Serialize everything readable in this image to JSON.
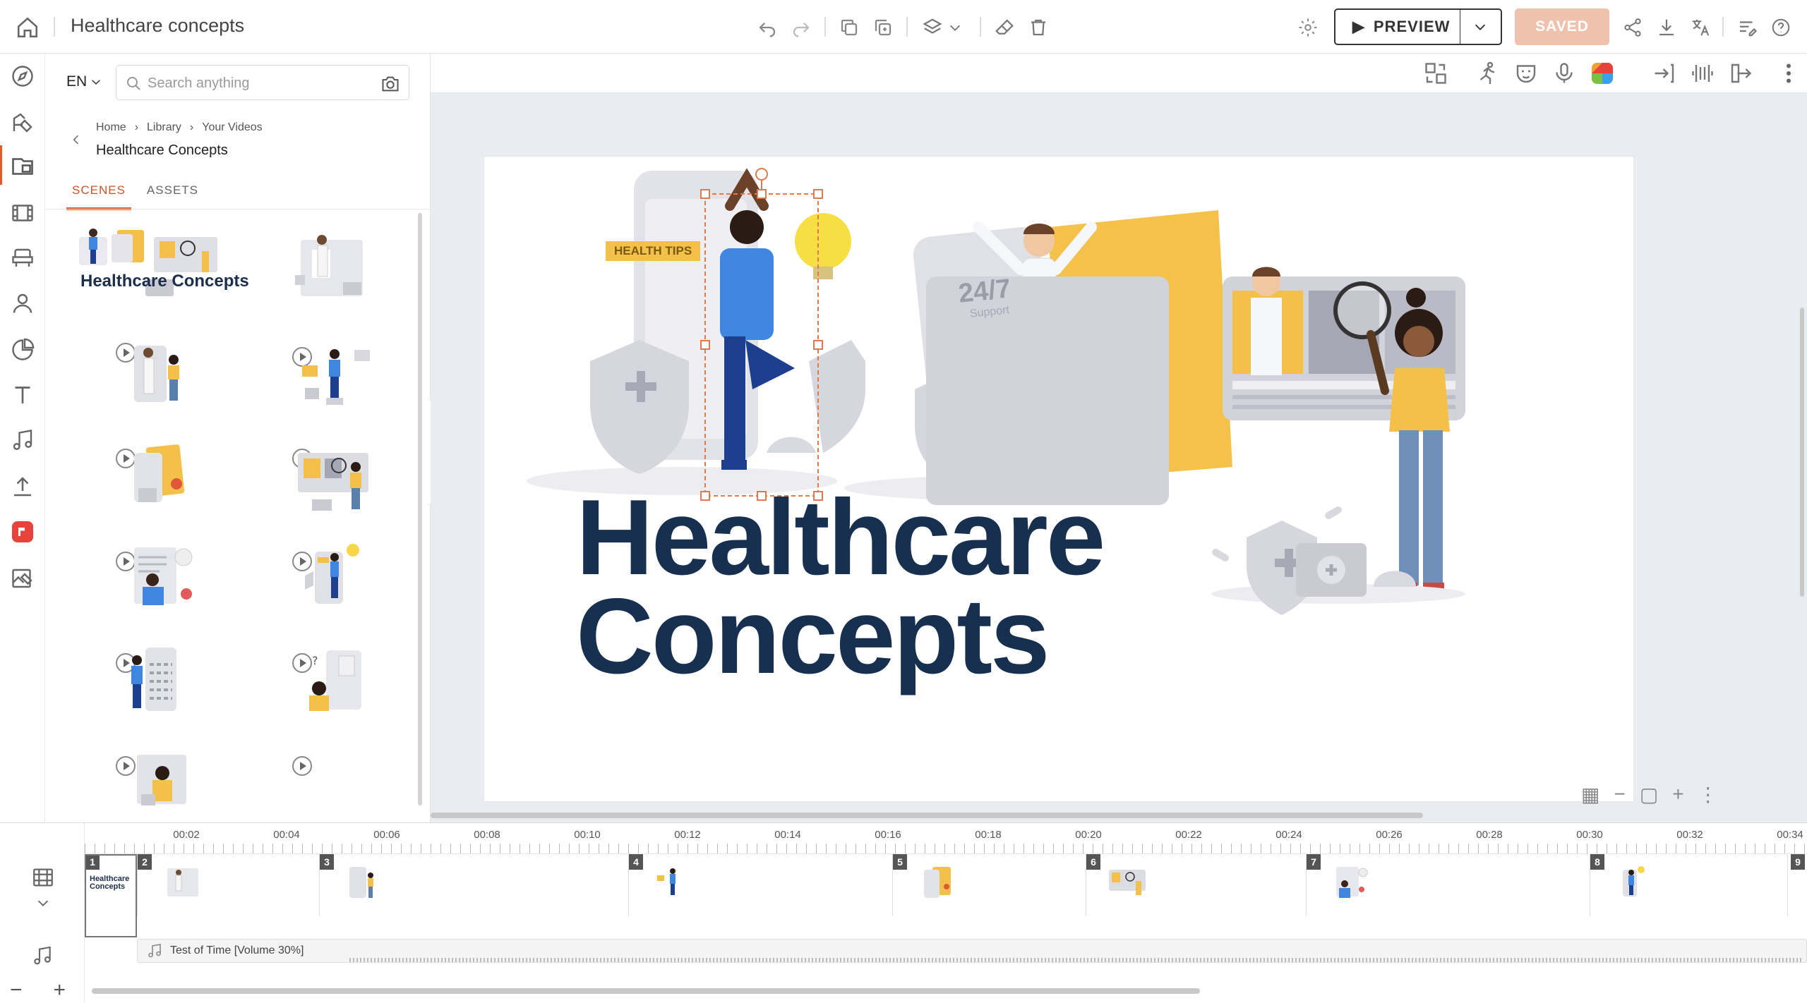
{
  "header": {
    "title": "Healthcare concepts",
    "preview_label": "PREVIEW",
    "saved_label": "SAVED"
  },
  "panel": {
    "language": "EN",
    "search": {
      "placeholder": "Search anything",
      "value": ""
    },
    "breadcrumbs": [
      "Home",
      "Library",
      "Your Videos"
    ],
    "current_folder": "Healthcare Concepts",
    "tabs": [
      "SCENES",
      "ASSETS"
    ],
    "active_tab": "SCENES",
    "thumb_title": "Healthcare Concepts"
  },
  "canvas": {
    "badge": "HEALTH TIPS",
    "headline_line1": "Healthcare",
    "headline_line2": "Concepts",
    "support_text": "24/7",
    "support_sub": "Support"
  },
  "timeline": {
    "ticks": [
      "00:02",
      "00:04",
      "00:06",
      "00:08",
      "00:10",
      "00:12",
      "00:14",
      "00:16",
      "00:18",
      "00:20",
      "00:22",
      "00:24",
      "00:26",
      "00:28",
      "00:30",
      "00:32",
      "00:34"
    ],
    "scene_numbers": [
      "1",
      "2",
      "3",
      "4",
      "5",
      "6",
      "7",
      "8",
      "9"
    ],
    "audio_label": "Test of Time [Volume 30%]",
    "scene1_title": "Healthcare Concepts"
  },
  "colors": {
    "accent": "#e05a2b",
    "saved_bg": "#eec2ad",
    "title_navy": "#17304f",
    "yellow": "#f3c14a",
    "blue_shirt": "#3f86e0"
  },
  "icons": {
    "topbar": [
      "home-icon",
      "undo-icon",
      "redo-icon",
      "copy-icon",
      "duplicate-icon",
      "layers-icon",
      "chevron-down-icon",
      "eraser-icon",
      "trash-icon",
      "settings-icon",
      "share-icon",
      "download-icon",
      "translate-icon",
      "notes-icon",
      "help-icon"
    ],
    "rail": [
      "compass-icon",
      "brush-icon",
      "library-icon",
      "film-icon",
      "chair-icon",
      "person-icon",
      "chart-icon",
      "text-icon",
      "music-icon",
      "upload-icon",
      "brand-icon",
      "image-edit-icon"
    ],
    "stage": [
      "swap-icon",
      "animate-icon",
      "mask-icon",
      "mic-icon",
      "color-icon",
      "enter-icon",
      "sound-wave-icon",
      "exit-icon",
      "more-icon"
    ]
  }
}
